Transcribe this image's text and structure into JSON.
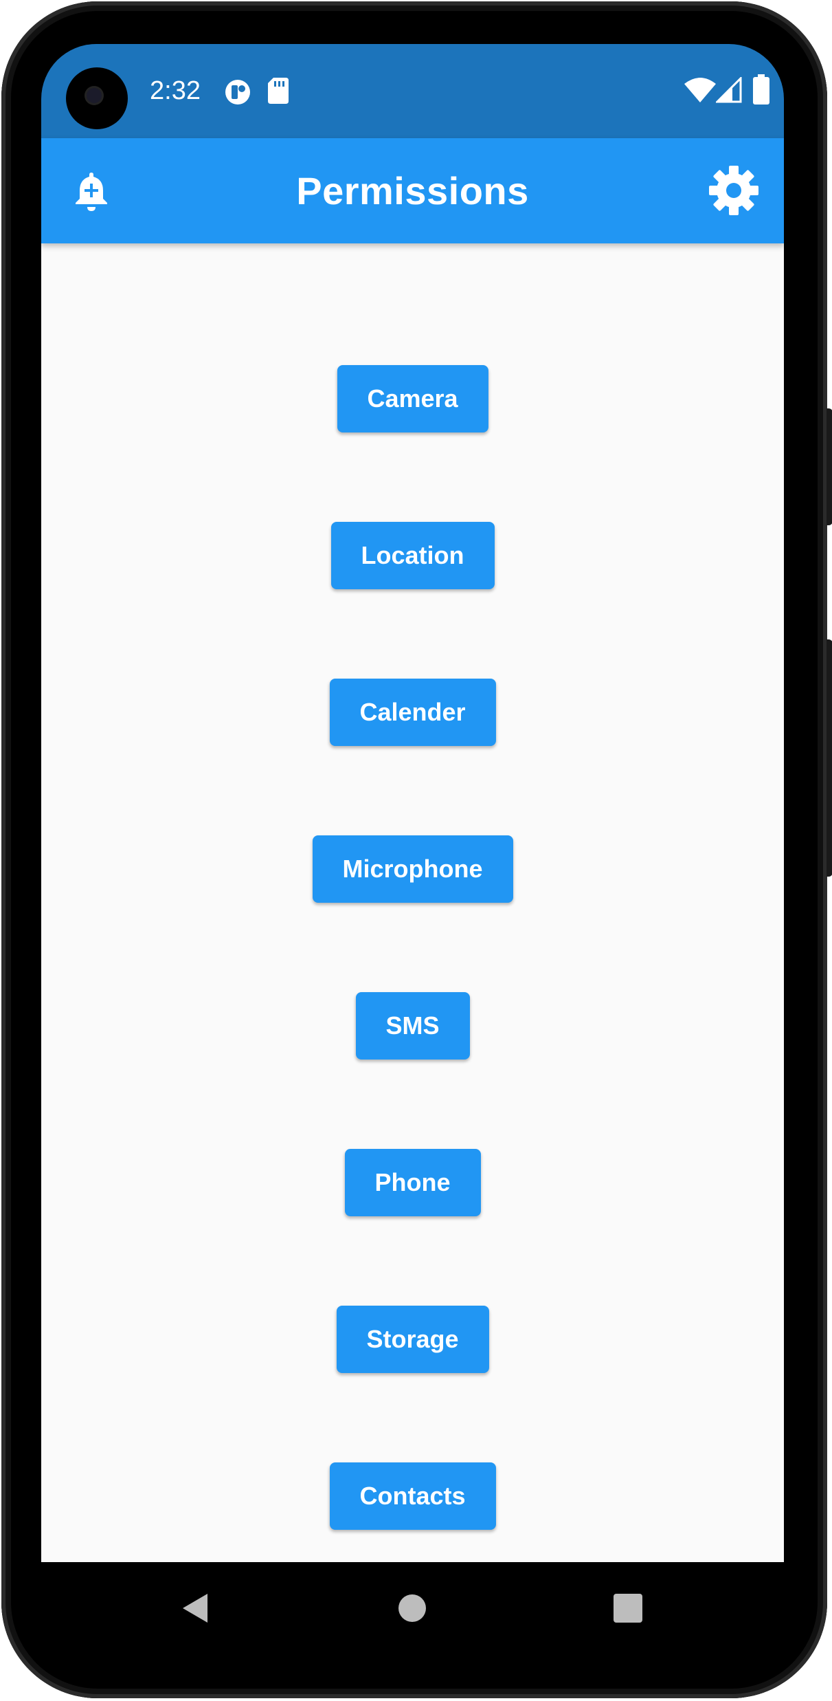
{
  "status_bar": {
    "time": "2:32",
    "icons": [
      "pocket-casts-icon",
      "sd-card-icon",
      "wifi-icon",
      "signal-icon",
      "battery-icon"
    ]
  },
  "app_bar": {
    "title": "Permissions",
    "left_icon": "notification-add-icon",
    "right_icon": "gear-icon",
    "background_color": "#2196F3",
    "status_color": "#1C74BB"
  },
  "permissions": [
    {
      "id": "camera",
      "label": "Camera"
    },
    {
      "id": "location",
      "label": "Location"
    },
    {
      "id": "calender",
      "label": "Calender"
    },
    {
      "id": "microphone",
      "label": "Microphone"
    },
    {
      "id": "sms",
      "label": "SMS"
    },
    {
      "id": "phone",
      "label": "Phone"
    },
    {
      "id": "storage",
      "label": "Storage"
    },
    {
      "id": "contacts",
      "label": "Contacts"
    }
  ],
  "nav_bar": {
    "buttons": [
      "back-icon",
      "home-icon",
      "recents-icon"
    ]
  }
}
